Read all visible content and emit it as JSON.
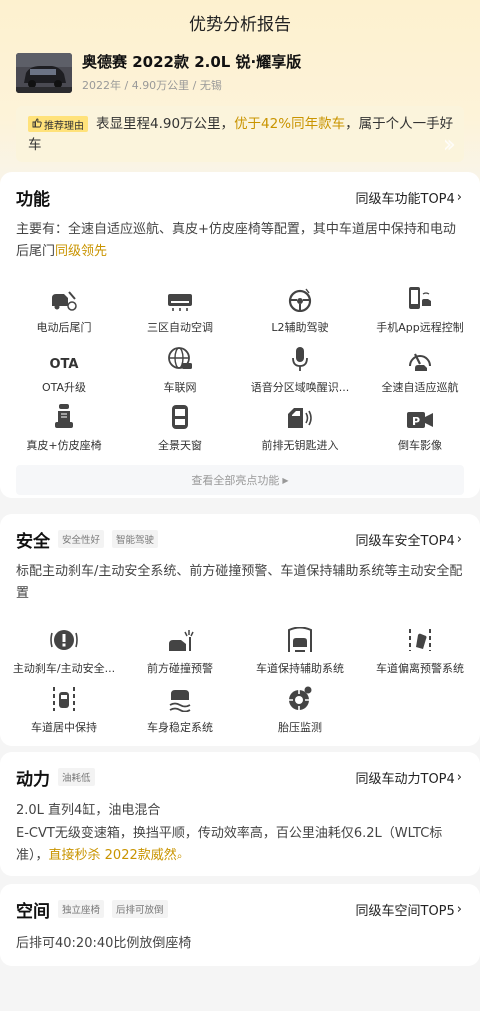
{
  "header": {
    "title": "优势分析报告"
  },
  "car": {
    "name": "奥德赛 2022款 2.0L 锐·耀享版",
    "meta": "2022年 / 4.90万公里 / 无锡"
  },
  "reason": {
    "badge": "推荐理由",
    "text_a": "表显里程4.90万公里，",
    "text_hl": "优于42%同年款车",
    "text_b": "，属于个人一手好车"
  },
  "features": {
    "title": "功能",
    "link": "同级车功能TOP4",
    "desc_a": "主要有：全速自适应巡航、真皮+仿皮座椅等配置，其中车道居中保持和电动后尾门",
    "desc_hl": "同级领先",
    "items": [
      {
        "label": "电动后尾门",
        "icon": "tailgate-icon"
      },
      {
        "label": "三区自动空调",
        "icon": "ac-icon"
      },
      {
        "label": "L2辅助驾驶",
        "icon": "steering-wheel-icon"
      },
      {
        "label": "手机App远程控制",
        "icon": "phone-car-icon"
      },
      {
        "label": "OTA升级",
        "icon": "ota-icon"
      },
      {
        "label": "车联网",
        "icon": "globe-car-icon"
      },
      {
        "label": "语音分区域唤醒识...",
        "icon": "microphone-icon"
      },
      {
        "label": "全速自适应巡航",
        "icon": "speedometer-icon"
      },
      {
        "label": "真皮+仿皮座椅",
        "icon": "seat-icon"
      },
      {
        "label": "全景天窗",
        "icon": "sunroof-icon"
      },
      {
        "label": "前排无钥匙进入",
        "icon": "keyless-door-icon"
      },
      {
        "label": "倒车影像",
        "icon": "camera-icon"
      }
    ],
    "view_all": "查看全部亮点功能"
  },
  "safety": {
    "title": "安全",
    "tags": [
      "安全性好",
      "智能驾驶"
    ],
    "link": "同级车安全TOP4",
    "desc": "标配主动刹车/主动安全系统、前方碰撞预警、车道保持辅助系统等主动安全配置",
    "items": [
      {
        "label": "主动刹车/主动安全...",
        "icon": "brake-icon"
      },
      {
        "label": "前方碰撞预警",
        "icon": "collision-icon"
      },
      {
        "label": "车道保持辅助系统",
        "icon": "lane-keep-icon"
      },
      {
        "label": "车道偏离预警系统",
        "icon": "lane-departure-icon"
      },
      {
        "label": "车道居中保持",
        "icon": "lane-center-icon"
      },
      {
        "label": "车身稳定系统",
        "icon": "stability-icon"
      },
      {
        "label": "胎压监测",
        "icon": "tire-pressure-icon"
      }
    ]
  },
  "power": {
    "title": "动力",
    "tag": "油耗低",
    "link": "同级车动力TOP4",
    "line1": "2.0L 直列4缸，油电混合",
    "line2_a": "E-CVT无级变速箱，换挡平顺，传动效率高，百公里油耗仅6.2L（WLTC标准），",
    "line2_hl": "直接秒杀 2022款威然",
    "accent": "#c99400"
  },
  "space": {
    "title": "空间",
    "tags": [
      "独立座椅",
      "后排可放倒"
    ],
    "link": "同级车空间TOP5",
    "desc": "后排可40:20:40比例放倒座椅"
  }
}
